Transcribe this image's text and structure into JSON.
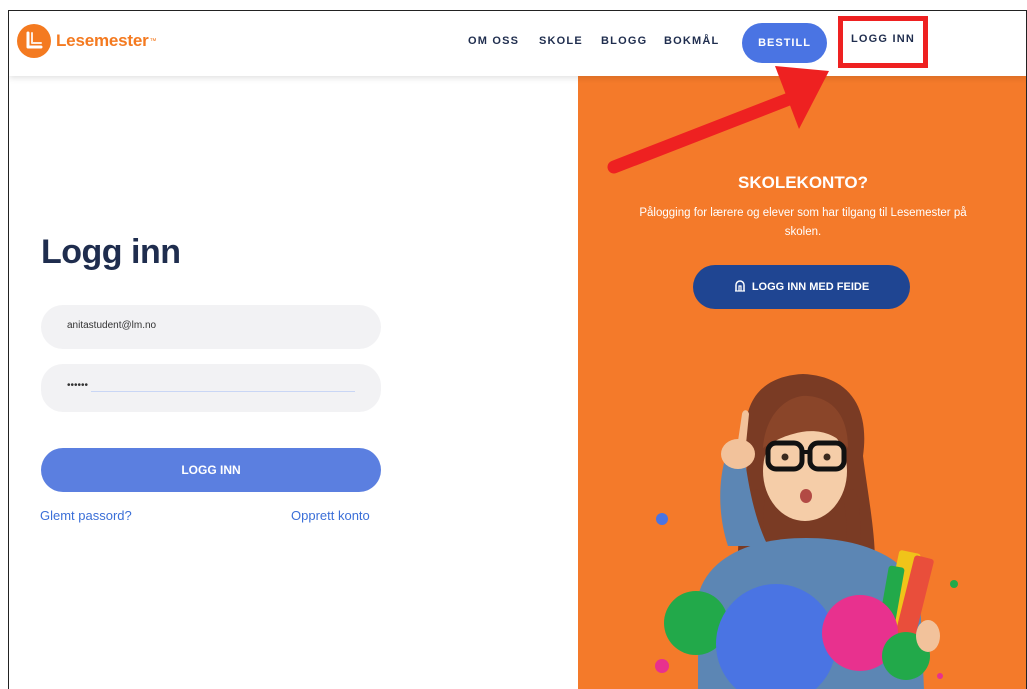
{
  "header": {
    "logo_text": "Lesemester",
    "logo_tm": "™",
    "nav": [
      "OM OSS",
      "SKOLE",
      "BLOGG",
      "BOKMÅL"
    ],
    "order_button": "BESTILL",
    "login_link": "LOGG INN"
  },
  "login": {
    "title": "Logg inn",
    "email_value": "anitastudent@lm.no",
    "password_value": "••••••",
    "submit_label": "LOGG INN",
    "forgot_link": "Glemt passord?",
    "create_link": "Opprett konto"
  },
  "school": {
    "title": "SKOLEKONTO?",
    "description": "Pålogging for lærere og elever som har tilgang til Lesemester på skolen.",
    "feide_button": "LOGG INN MED FEIDE",
    "feide_icon": "feide-icon"
  },
  "colors": {
    "brand_orange": "#f47a20",
    "panel_orange": "#f47a2a",
    "primary_blue": "#4a74e3",
    "feide_blue": "#1f4592",
    "title_navy": "#1f2d4e",
    "highlight_red": "#ee2121"
  }
}
